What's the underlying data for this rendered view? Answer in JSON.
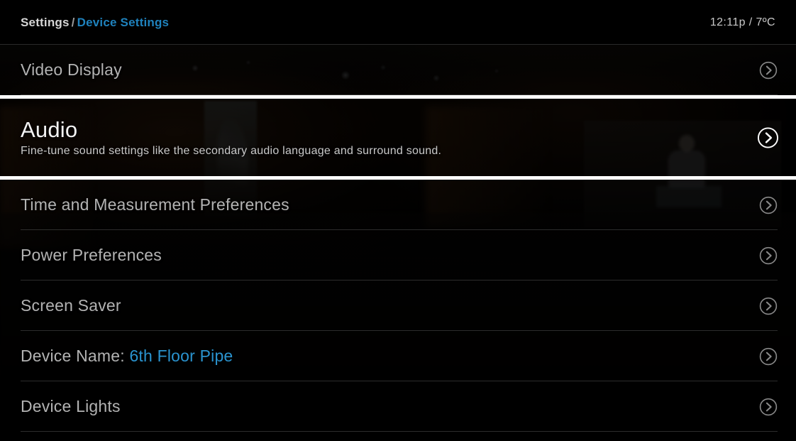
{
  "header": {
    "breadcrumb": {
      "root": "Settings",
      "separator": "/",
      "current": "Device Settings"
    },
    "status": "12:11p / 7ºC"
  },
  "colors": {
    "accent_blue": "#1f82bd",
    "value_blue": "#2a93cf",
    "selection_border": "#ffffff",
    "label_gray": "#b3b3b3",
    "background": "#000000"
  },
  "menu": {
    "items": [
      {
        "label": "Video Display",
        "value": "",
        "description": "",
        "selected": false,
        "chevron_icon": "chevron-right-circle-icon"
      },
      {
        "label": "Audio",
        "value": "",
        "description": "Fine-tune sound settings like the secondary audio language and surround sound.",
        "selected": true,
        "chevron_icon": "chevron-right-circle-icon"
      },
      {
        "label": "Time and Measurement Preferences",
        "value": "",
        "description": "",
        "selected": false,
        "chevron_icon": "chevron-right-circle-icon"
      },
      {
        "label": "Power Preferences",
        "value": "",
        "description": "",
        "selected": false,
        "chevron_icon": "chevron-right-circle-icon"
      },
      {
        "label": "Screen Saver",
        "value": "",
        "description": "",
        "selected": false,
        "chevron_icon": "chevron-right-circle-icon"
      },
      {
        "label": "Device Name:",
        "value": "6th Floor Pipe",
        "description": "",
        "selected": false,
        "chevron_icon": "chevron-right-circle-icon"
      },
      {
        "label": "Device Lights",
        "value": "",
        "description": "",
        "selected": false,
        "chevron_icon": "chevron-right-circle-icon"
      }
    ]
  }
}
